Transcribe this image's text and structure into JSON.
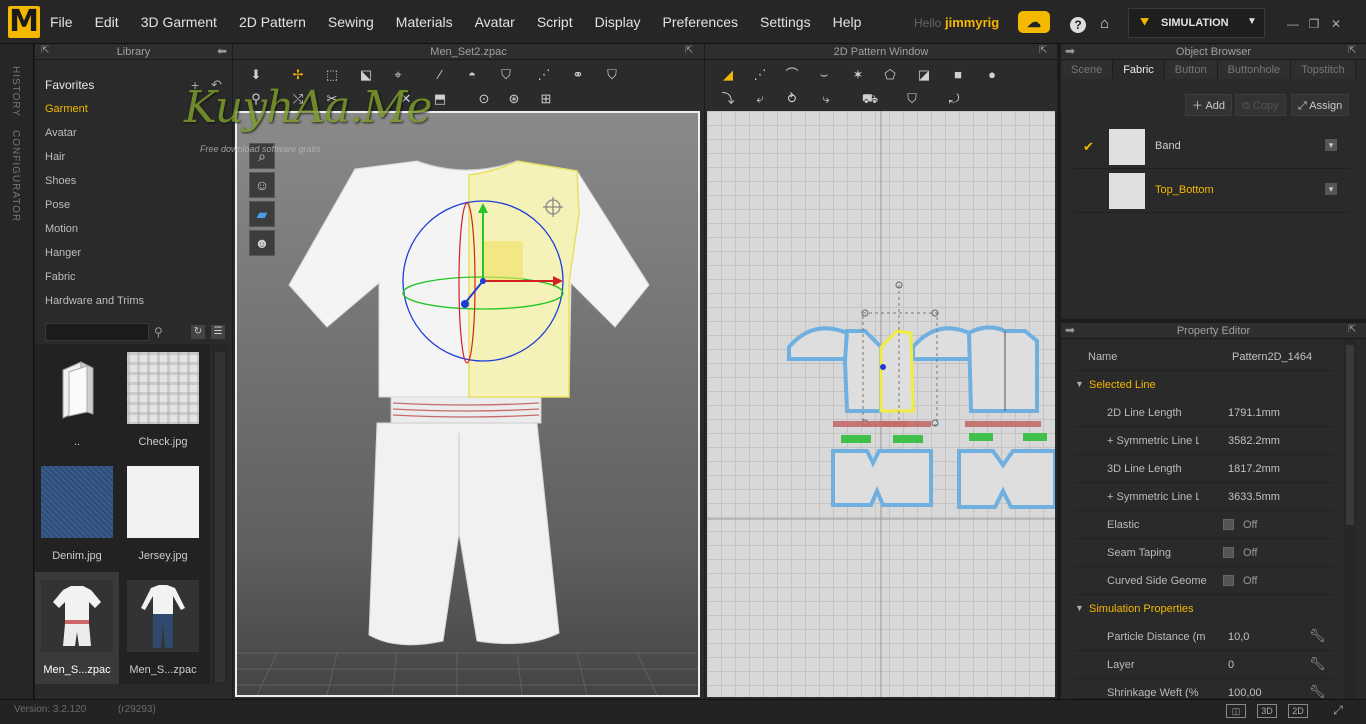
{
  "app": {
    "logo_letter": "M",
    "menu": [
      "File",
      "Edit",
      "3D Garment",
      "2D Pattern",
      "Sewing",
      "Materials",
      "Avatar",
      "Script",
      "Display",
      "Preferences",
      "Settings",
      "Help"
    ],
    "hello": "Hello",
    "username": "jimmyrig",
    "mode_label": "SIMULATION",
    "accent_color": "#f5b800"
  },
  "side_tabs": [
    "HISTORY",
    "CONFIGURATOR"
  ],
  "library": {
    "title": "Library",
    "favorites": "Favorites",
    "categories": [
      {
        "label": "Garment",
        "active": true
      },
      {
        "label": "Avatar",
        "active": false
      },
      {
        "label": "Hair",
        "active": false
      },
      {
        "label": "Shoes",
        "active": false
      },
      {
        "label": "Pose",
        "active": false
      },
      {
        "label": "Motion",
        "active": false
      },
      {
        "label": "Hanger",
        "active": false
      },
      {
        "label": "Fabric",
        "active": false
      },
      {
        "label": "Hardware and Trims",
        "active": false
      }
    ],
    "search_placeholder": "",
    "items": [
      {
        "label": "..",
        "kind": "folder"
      },
      {
        "label": "Check.jpg",
        "kind": "check"
      },
      {
        "label": "Denim.jpg",
        "kind": "denim"
      },
      {
        "label": "Jersey.jpg",
        "kind": "jersey"
      },
      {
        "label": "Men_S...zpac",
        "kind": "garment-shorts",
        "selected": true
      },
      {
        "label": "Men_S...zpac",
        "kind": "garment-pants",
        "selected": false
      }
    ]
  },
  "window3d": {
    "title": "Men_Set2.zpac"
  },
  "window2d": {
    "title": "2D Pattern Window"
  },
  "watermark": {
    "text": "KuyhAa.Me",
    "sub": "Free download software gratis"
  },
  "object_browser": {
    "title": "Object Browser",
    "tabs": [
      {
        "label": "Scene",
        "active": false
      },
      {
        "label": "Fabric",
        "active": true
      },
      {
        "label": "Button",
        "active": false
      },
      {
        "label": "Buttonhole",
        "active": false
      },
      {
        "label": "Topstitch",
        "active": false
      }
    ],
    "add_label": "Add",
    "copy_label": "Copy",
    "assign_label": "Assign",
    "fabrics": [
      {
        "name": "Band",
        "checked": true,
        "highlight": false
      },
      {
        "name": "Top_Bottom",
        "checked": false,
        "highlight": true
      }
    ]
  },
  "property_editor": {
    "title": "Property Editor",
    "name_label": "Name",
    "name_value": "Pattern2D_1464",
    "sections": {
      "selected_line": "Selected Line",
      "simulation": "Simulation Properties"
    },
    "selected_line": [
      {
        "key": "2D Line Length",
        "value": "1791.1mm",
        "indent": false
      },
      {
        "key": "+ Symmetric Line Le",
        "value": "3582.2mm",
        "indent": true
      },
      {
        "key": "3D Line Length",
        "value": "1817.2mm",
        "indent": false
      },
      {
        "key": "+ Symmetric Line Le",
        "value": "3633.5mm",
        "indent": true
      }
    ],
    "toggles": [
      {
        "key": "Elastic",
        "value": "Off"
      },
      {
        "key": "Seam Taping",
        "value": "Off"
      },
      {
        "key": "Curved Side Geome",
        "value": "Off"
      }
    ],
    "simulation": [
      {
        "key": "Particle Distance (m",
        "value": "10,0"
      },
      {
        "key": "Layer",
        "value": "0"
      },
      {
        "key": "Shrinkage Weft (%",
        "value": "100,00"
      }
    ]
  },
  "status": {
    "version": "Version: 3.2.120",
    "build": "(r29293)",
    "view_3d": "3D",
    "view_2d": "2D"
  }
}
